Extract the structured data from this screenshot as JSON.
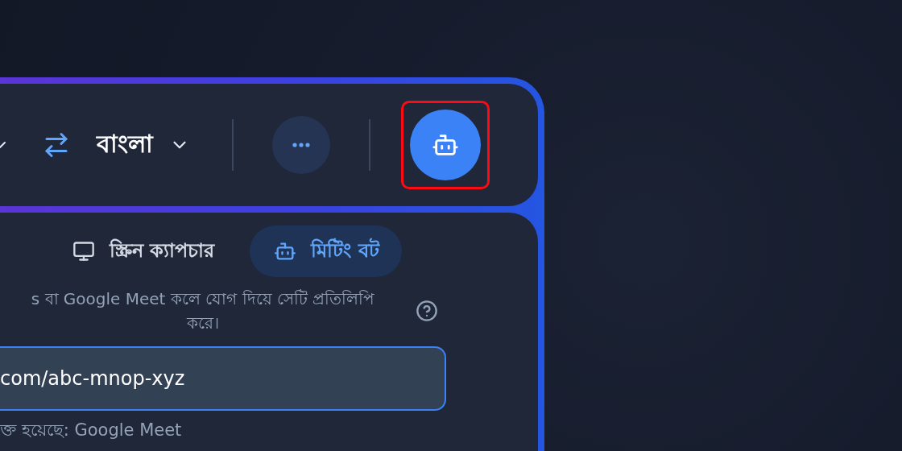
{
  "toolbar": {
    "target_language": "বাংলা",
    "bot_button": {
      "highlighted": true
    }
  },
  "mode_tabs": [
    {
      "kind": "screen",
      "label": "স্ক্রিন ক্যাপচার",
      "selected": false
    },
    {
      "kind": "bot",
      "label": "মিটিং বট",
      "selected": true
    }
  ],
  "description": "s বা Google Meet কলে যোগ দিয়ে সেটি প্রতিলিপি\nকরে।",
  "meeting_url": {
    "value": "com/abc-mnop-xyz"
  },
  "detected_platform": "ক্ত হয়েছে: Google Meet"
}
